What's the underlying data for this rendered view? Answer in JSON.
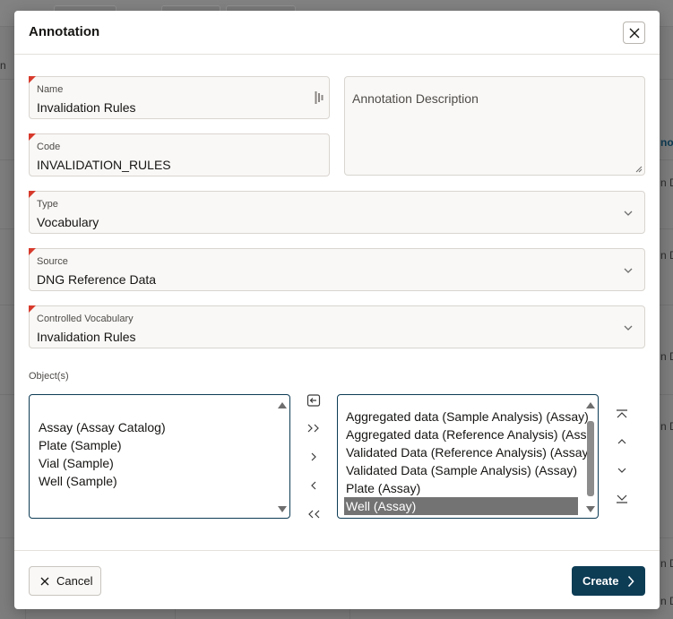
{
  "dialog": {
    "title": "Annotation",
    "close_icon": "close-icon"
  },
  "fields": {
    "name": {
      "label": "Name",
      "value": "Invalidation Rules"
    },
    "code": {
      "label": "Code",
      "value": "INVALIDATION_RULES"
    },
    "description": {
      "placeholder": "Annotation Description"
    },
    "type": {
      "label": "Type",
      "value": "Vocabulary"
    },
    "source": {
      "label": "Source",
      "value": "DNG Reference Data"
    },
    "controlled_vocabulary": {
      "label": "Controlled Vocabulary",
      "value": "Invalidation Rules"
    }
  },
  "objects": {
    "label": "Object(s)",
    "available": [
      "Assay (Assay Catalog)",
      "Plate (Sample)",
      "Vial (Sample)",
      "Well (Sample)"
    ],
    "selected": [
      "Aggregated data (Sample Analysis) (Assay)",
      "Aggregated data (Reference Analysis) (Assay)",
      "Validated Data (Reference Analysis) (Assay)",
      "Validated Data (Sample Analysis) (Assay)",
      "Plate (Assay)",
      "Well (Assay)"
    ],
    "selected_highlight": "Well (Assay)",
    "transfer_controls": {
      "move_all_right": ">>",
      "move_right": ">",
      "move_left": "<",
      "move_all_left": "<<"
    }
  },
  "footer": {
    "cancel_label": "Cancel",
    "create_label": "Create"
  },
  "background": {
    "left_cut_text": "n",
    "right_cut_texts": [
      "no",
      "n D",
      "n D",
      "n D",
      "n D",
      "n D",
      "n D"
    ]
  },
  "colors": {
    "primary": "#0d3c55",
    "required_marker": "#d73a2c",
    "selected_option": "#737373"
  }
}
